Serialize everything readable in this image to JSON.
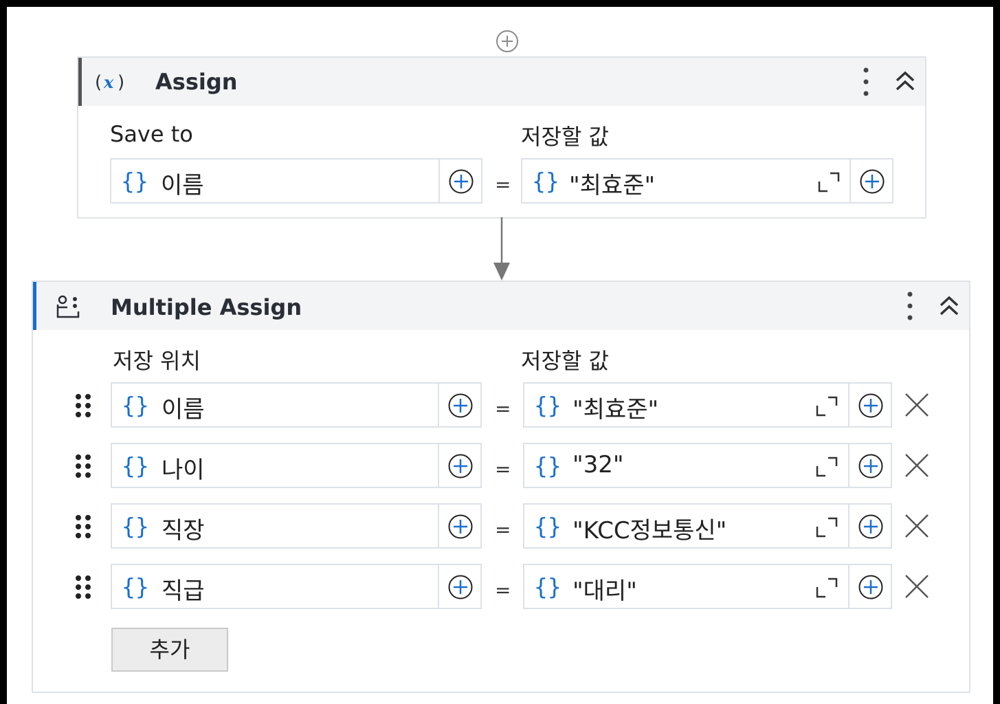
{
  "assign": {
    "title": "Assign",
    "save_to_label": "Save to",
    "value_label": "저장할 값",
    "to_value": "이름",
    "value": "\"최효준\""
  },
  "multiple_assign": {
    "title": "Multiple Assign",
    "to_label": "저장 위치",
    "value_label": "저장할 값",
    "rows": [
      {
        "to": "이름",
        "value": "\"최효준\""
      },
      {
        "to": "나이",
        "value": "\"32\""
      },
      {
        "to": "직장",
        "value": "\"KCC정보통신\""
      },
      {
        "to": "직급",
        "value": "\"대리\""
      }
    ],
    "add_button": "추가"
  },
  "equals_sign": "=",
  "brace_symbol": "{}",
  "colors": {
    "accent_blue": "#1a6fd0",
    "assign_bar": "#555555",
    "multi_bar": "#1a6fd0"
  },
  "icons": [
    "plus-circle-icon",
    "variable-icon",
    "multiple-assign-icon",
    "more-vertical-icon",
    "collapse-icon",
    "expand-icon",
    "drag-handle-icon",
    "close-icon",
    "arrow-down-icon"
  ]
}
